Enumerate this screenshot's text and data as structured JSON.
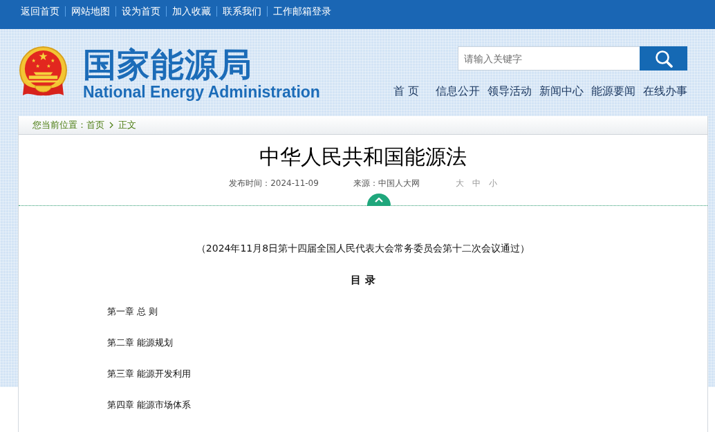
{
  "top_links": [
    "返回首页",
    "网站地图",
    "设为首页",
    "加入收藏",
    "联系我们",
    "工作邮箱登录"
  ],
  "header": {
    "logo_cn": "国家能源局",
    "logo_en": "National Energy Administration"
  },
  "search": {
    "placeholder": "请输入关键字"
  },
  "nav": [
    "首 页",
    "信息公开",
    "领导活动",
    "新闻中心",
    "能源要闻",
    "在线办事"
  ],
  "breadcrumb": {
    "label": "您当前位置：",
    "items": [
      "首页",
      "正文"
    ]
  },
  "article": {
    "title": "中华人民共和国能源法",
    "date": "发布时间：2024-11-09",
    "source": "来源：中国人大网",
    "font_sizes": [
      "大",
      "中",
      "小"
    ],
    "note": "（2024年11月8日第十四届全国人民代表大会常务委员会第十二次会议通过）",
    "toc_heading": "目 录",
    "toc": [
      "第一章 总 则",
      "第二章 能源规划",
      "第三章 能源开发利用",
      "第四章 能源市场体系"
    ]
  }
}
